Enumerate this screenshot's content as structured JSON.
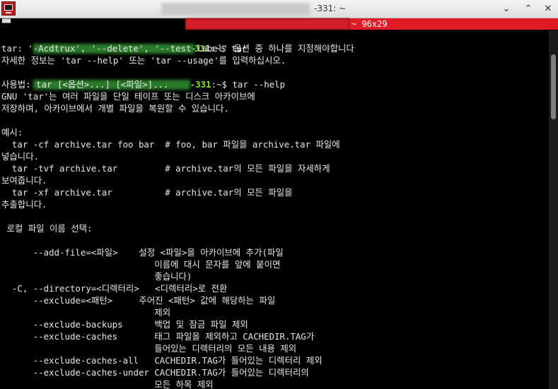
{
  "window": {
    "title_suffix": "-331: ~",
    "minimize_glyph": "⌄",
    "maximize_glyph": "⌃",
    "close_glyph": "✕"
  },
  "tabbar": {
    "left_glyph": "▀▀",
    "size_label": "~ 96x29"
  },
  "terminal": {
    "prompt_host": "331",
    "prompt_host2": "-331",
    "prompt_sep": ":~$ ",
    "lines": [
      "tar: '-Acdtrux', '--delete', '--test-label' 옵션 중 하나를 지정해야합니다",
      "자세한 정보는 'tar --help' 또는 'tar --usage'를 입력하십시오.",
      "사용법: tar [<옵션>...] [<파일>]...",
      "GNU 'tar'는 여러 파일을 단일 테이프 또는 디스크 아카이브에",
      "저장하며, 아카이브에서 개별 파일을 복원할 수 있습니다.",
      "",
      "예시:",
      "  tar -cf archive.tar foo bar  # foo, bar 파일을 archive.tar 파일에",
      "넣습니다.",
      "  tar -tvf archive.tar         # archive.tar의 모든 파일을 자세하게",
      "보여줍니다.",
      "  tar -xf archive.tar          # archive.tar의 모든 파일을",
      "추출합니다.",
      "",
      " 로컬 파일 이름 선택:",
      "",
      "      --add-file=<파일>    설정 <파일>을 아카이브에 추가(파일",
      "                             이름에 대시 문자를 앞에 붙이면",
      "                             좋습니다)",
      "  -C, --directory=<디렉터리>   <디렉터리>로 전환",
      "      --exclude=<패턴>     주어진 <패턴> 값에 해당하는 파일",
      "                             제외",
      "      --exclude-backups      백업 및 잠금 파일 제외",
      "      --exclude-caches       태그 파일을 제외하고 CACHEDIR.TAG가",
      "                             들어있는 디렉터리의 모든 내용 제외",
      "      --exclude-caches-all   CACHEDIR.TAG가 들어있는 디렉터리 제외",
      "      --exclude-caches-under CACHEDIR.TAG가 들어있는 디렉터리의",
      "                             모든 하목 제외"
    ],
    "cmd1": "tar",
    "cmd2": "tar --help"
  }
}
